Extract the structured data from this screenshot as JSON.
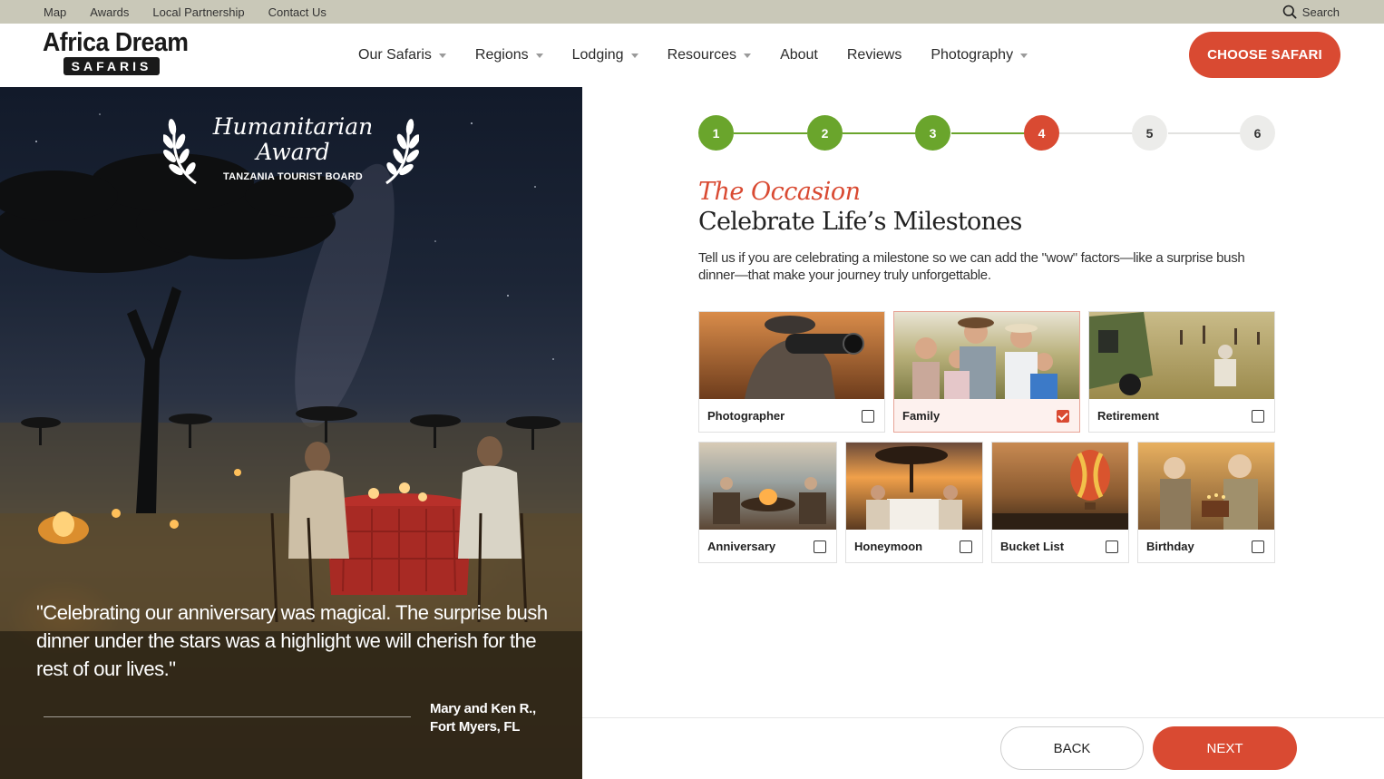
{
  "topbar": {
    "links": [
      "Map",
      "Awards",
      "Local Partnership",
      "Contact Us"
    ],
    "search_label": "Search"
  },
  "header": {
    "logo_line1": "Africa Dream",
    "logo_line2": "SAFARIS",
    "nav": [
      {
        "label": "Our Safaris",
        "has_menu": true
      },
      {
        "label": "Regions",
        "has_menu": true
      },
      {
        "label": "Lodging",
        "has_menu": true
      },
      {
        "label": "Resources",
        "has_menu": true
      },
      {
        "label": "About",
        "has_menu": false
      },
      {
        "label": "Reviews",
        "has_menu": false
      },
      {
        "label": "Photography",
        "has_menu": true
      }
    ],
    "cta_label": "CHOOSE SAFARI"
  },
  "hero": {
    "award_line1": "Humanitarian",
    "award_line2": "Award",
    "award_org": "TANZANIA TOURIST BOARD",
    "quote": "\"Celebrating our anniversary was magical. The surprise bush dinner under the stars was a highlight we will cherish for the rest of our lives.\"",
    "attribution_name": "Mary and Ken R.,",
    "attribution_place": "Fort Myers, FL"
  },
  "stepper": {
    "steps": [
      "1",
      "2",
      "3",
      "4",
      "5",
      "6"
    ],
    "current_step": 4,
    "colors": {
      "done": "#6aa52c",
      "current": "#d94a32",
      "todo": "#ececea"
    }
  },
  "step": {
    "eyebrow": "The Occasion",
    "headline": "Celebrate Life’s Milestones",
    "description": "Tell us if you are celebrating a milestone so we can add the \"wow\" factors—like a surprise bush dinner—that make your journey truly unforgettable."
  },
  "occasions": [
    {
      "label": "Photographer",
      "checked": false
    },
    {
      "label": "Family",
      "checked": true
    },
    {
      "label": "Retirement",
      "checked": false
    },
    {
      "label": "Anniversary",
      "checked": false
    },
    {
      "label": "Honeymoon",
      "checked": false
    },
    {
      "label": "Bucket List",
      "checked": false
    },
    {
      "label": "Birthday",
      "checked": false
    }
  ],
  "actions": {
    "back_label": "BACK",
    "next_label": "NEXT"
  },
  "brand_colors": {
    "accent": "#d94a32",
    "success": "#6aa52c",
    "topbar": "#c9c8b8"
  }
}
